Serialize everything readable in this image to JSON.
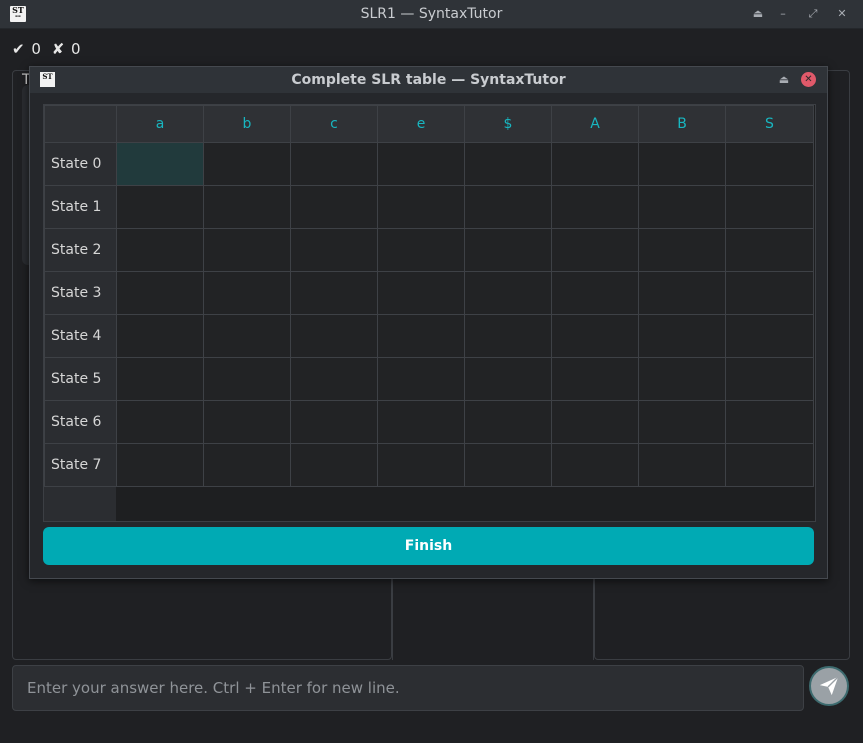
{
  "window": {
    "title": "SLR1 — SyntaxTutor",
    "icon_text": "ST"
  },
  "score": {
    "correct_symbol": "✔",
    "correct_count": "0",
    "wrong_symbol": "✘",
    "wrong_count": "0"
  },
  "background": {
    "partial_letter": "T"
  },
  "dialog": {
    "title": "Complete SLR table — SyntaxTutor",
    "icon_text": "ST",
    "columns": [
      "a",
      "b",
      "c",
      "e",
      "$",
      "A",
      "B",
      "S"
    ],
    "rows": [
      "State 0",
      "State 1",
      "State 2",
      "State 3",
      "State 4",
      "State 5",
      "State 6",
      "State 7"
    ],
    "finish_label": "Finish"
  },
  "answer": {
    "placeholder": "Enter your answer here. Ctrl + Enter for new line.",
    "value": ""
  },
  "colors": {
    "accent": "#00aab4",
    "header_text": "#18b6c0",
    "close_button": "#e0596a"
  }
}
